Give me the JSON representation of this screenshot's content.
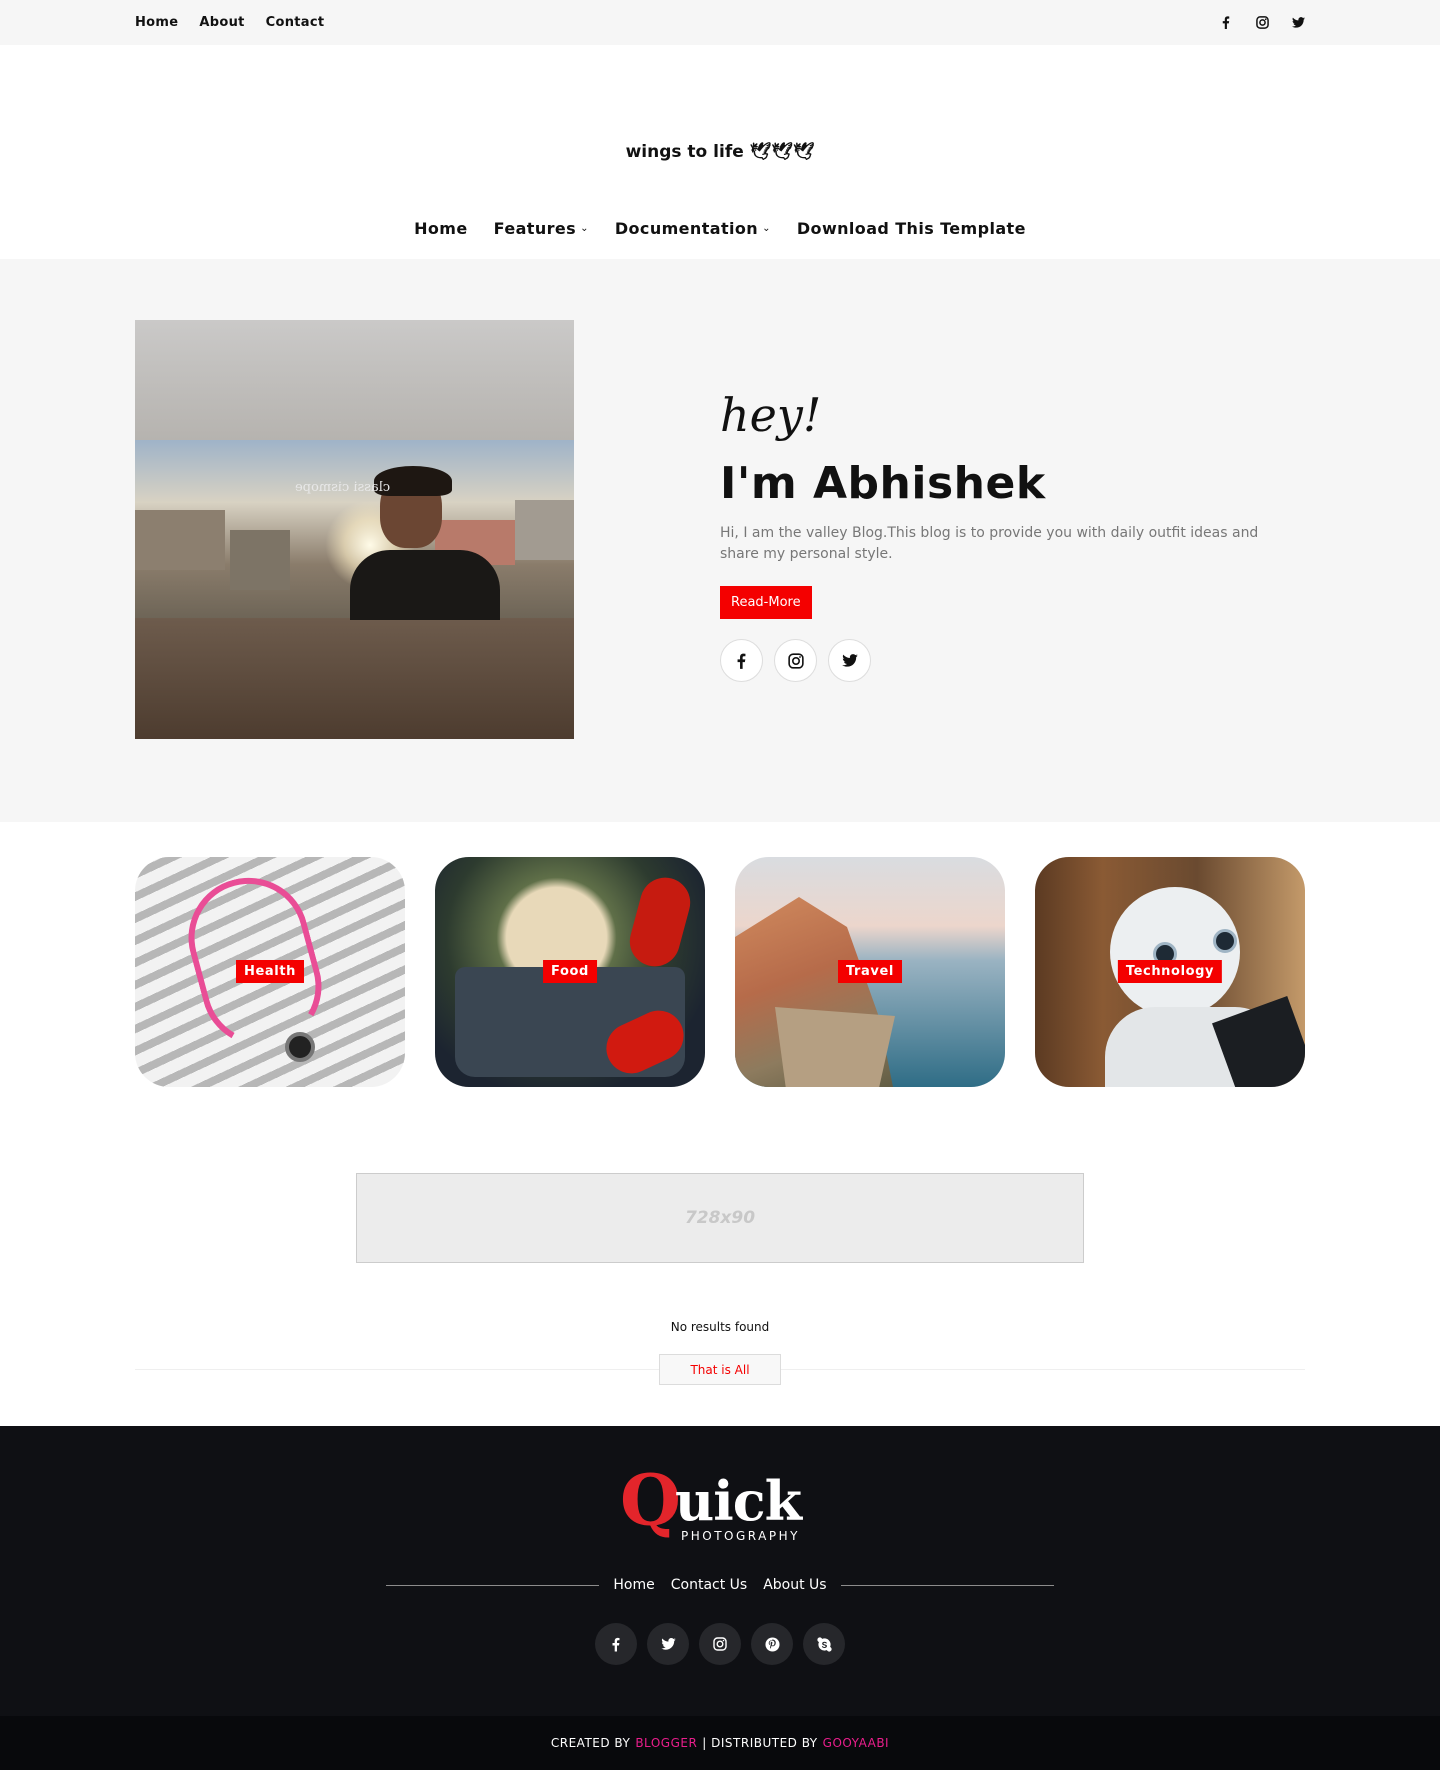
{
  "topbar": {
    "nav": [
      "Home",
      "About",
      "Contact"
    ],
    "social_icons": [
      "facebook-icon",
      "instagram-icon",
      "twitter-icon"
    ]
  },
  "header": {
    "site_title": "wings to life 🕊🕊🕊",
    "nav": [
      {
        "label": "Home",
        "has_dropdown": false
      },
      {
        "label": "Features",
        "has_dropdown": true
      },
      {
        "label": "Documentation",
        "has_dropdown": true
      },
      {
        "label": "Download This Template",
        "has_dropdown": false
      }
    ]
  },
  "hero": {
    "photo_shirt_text": "classi cismope",
    "greeting": "hey!",
    "name": "I'm Abhishek",
    "description": "Hi, I am the valley Blog.This blog is to provide you with daily outfit ideas and share my personal style.",
    "button_label": "Read-More",
    "social_icons": [
      "facebook-icon",
      "instagram-icon",
      "twitter-icon"
    ]
  },
  "categories": [
    {
      "label": "Health"
    },
    {
      "label": "Food"
    },
    {
      "label": "Travel"
    },
    {
      "label": "Technology"
    }
  ],
  "ad": {
    "text": "728x90"
  },
  "posts": {
    "empty_text": "No results found",
    "end_label": "That is All"
  },
  "footer": {
    "logo": {
      "first_letter": "Q",
      "rest": "uick",
      "subtitle": "PHOTOGRAPHY"
    },
    "nav": [
      "Home",
      "Contact Us",
      "About Us"
    ],
    "social_icons": [
      "facebook-icon",
      "twitter-icon",
      "instagram-icon",
      "pinterest-icon",
      "skype-icon"
    ],
    "credits": {
      "created_prefix": "CREATED BY",
      "created_by": "BLOGGER",
      "distributed_prefix": "| DISTRIBUTED BY",
      "distributed_by": "GOOYAABI"
    }
  },
  "colors": {
    "accent": "#f40000",
    "footer_bg": "#0f1014",
    "credit_link": "#e91e8c",
    "logo_red": "#e3252b"
  }
}
